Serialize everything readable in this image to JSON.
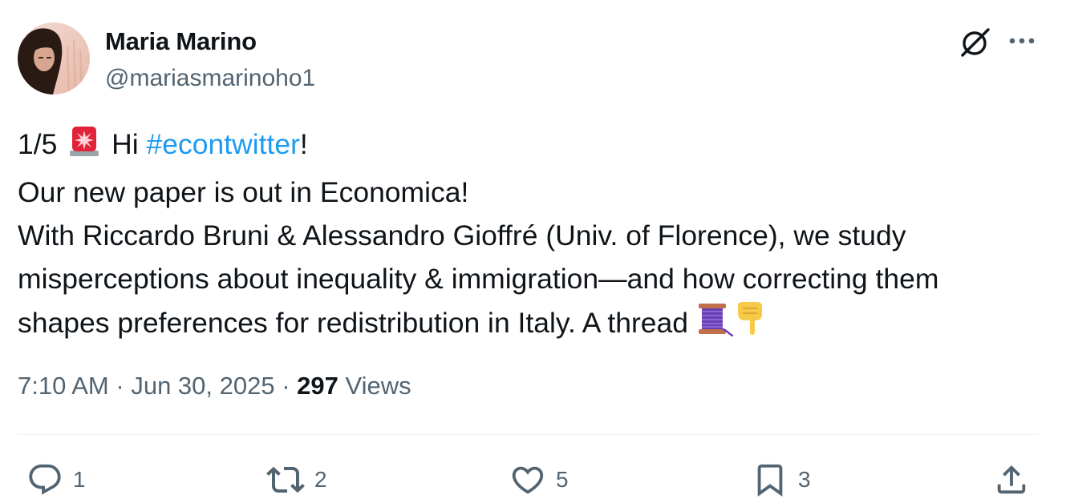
{
  "author": {
    "display_name": "Maria Marino",
    "handle": "@mariasmarinoho1"
  },
  "tweet": {
    "line1_prefix": "1/5",
    "line1_mid": "Hi",
    "hashtag": "#econtwitter",
    "line1_suffix": "!",
    "line2": "Our new paper is out in Economica!",
    "line3": "With Riccardo Bruni & Alessandro Gioffré (Univ. of Florence), we study",
    "line4": "misperceptions about inequality & immigration—and how correcting them",
    "line5": "shapes preferences for redistribution in Italy. A thread"
  },
  "meta": {
    "time": "7:10 AM",
    "date": "Jun 30, 2025",
    "views_count": "297",
    "views_label": "Views",
    "separator": "·"
  },
  "actions": {
    "replies": "1",
    "reposts": "2",
    "likes": "5",
    "bookmarks": "3"
  },
  "icons": {
    "top_right": [
      "grok-icon",
      "more-icon"
    ],
    "actions": [
      "reply-icon",
      "repost-icon",
      "like-icon",
      "bookmark-icon",
      "share-icon"
    ],
    "emojis": [
      "rotating-light-emoji",
      "thread-spool-emoji",
      "pointing-down-emoji"
    ]
  },
  "colors": {
    "link": "#1d9bf0",
    "secondary_text": "#536471",
    "primary_text": "#0f1419",
    "divider": "#eff3f4"
  }
}
